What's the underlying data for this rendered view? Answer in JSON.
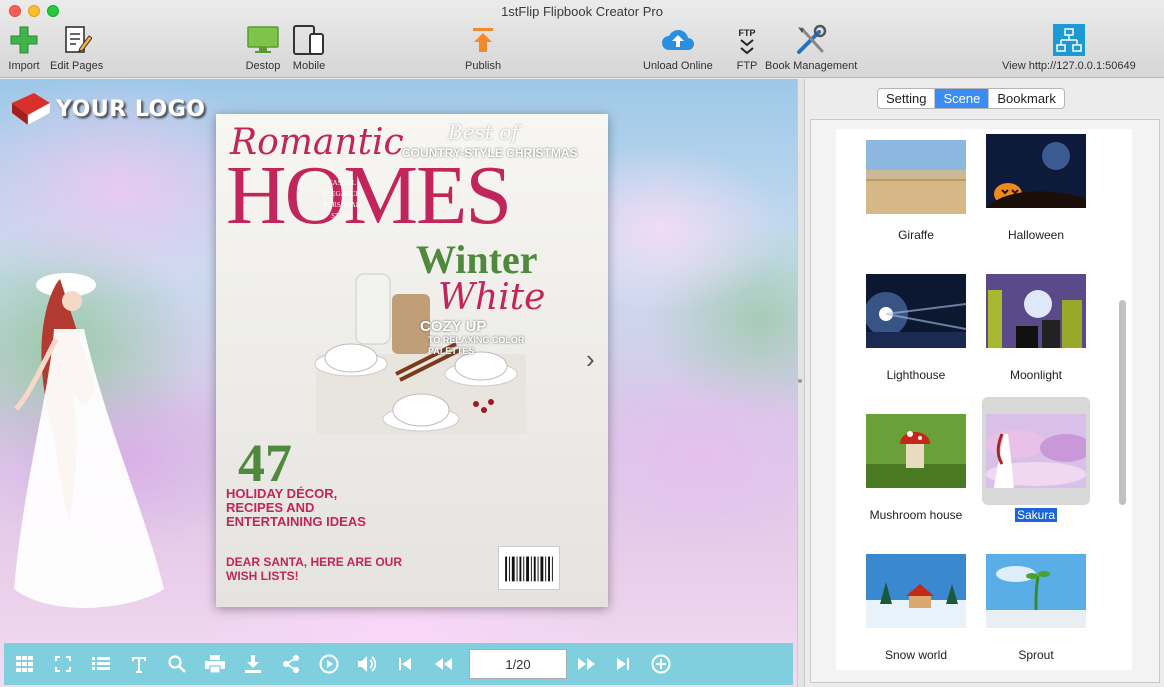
{
  "window": {
    "title": "1stFlip Flipbook Creator Pro"
  },
  "toolbar": {
    "import": "Import",
    "edit_pages": "Edit Pages",
    "desktop": "Destop",
    "mobile": "Mobile",
    "publish": "Publish",
    "upload_online": "Unload Online",
    "ftp": "FTP",
    "ftp_icon_text": "FTP",
    "book_management": "Book Management",
    "view": "View http://127.0.0.1:50649"
  },
  "stage": {
    "logo_text": "YOUR LOGO",
    "magazine": {
      "romantic": "Romantic",
      "best_of": "Best of",
      "country": "COUNTRY-STYLE CHRISTMAS",
      "homes": "HOMES",
      "casual": "CASUAL ELEGANCE, PERSONAL STYLE",
      "winter": "Winter",
      "white": "White",
      "cozy": "COZY UP",
      "relaxing": "TO RELAXING COLOR PALETTES",
      "number": "47",
      "holiday": "HOLIDAY DÉCOR, RECIPES AND ENTERTAINING IDEAS",
      "santa": "DEAR SANTA, HERE ARE OUR WISH LISTS!"
    },
    "page_indicator": "1/20"
  },
  "panel": {
    "tabs": [
      "Setting",
      "Scene",
      "Bookmark"
    ],
    "active_tab": "Scene",
    "scenes": [
      "Giraffe",
      "Halloween",
      "Lighthouse",
      "Moonlight",
      "Mushroom house",
      "Sakura",
      "Snow world",
      "Sprout"
    ],
    "selected_scene": "Sakura"
  },
  "colors": {
    "control_bar": "#7fcfdf",
    "accent": "#3b8df5",
    "magazine_pink": "#c2255c",
    "magazine_green": "#4f8a3c"
  }
}
